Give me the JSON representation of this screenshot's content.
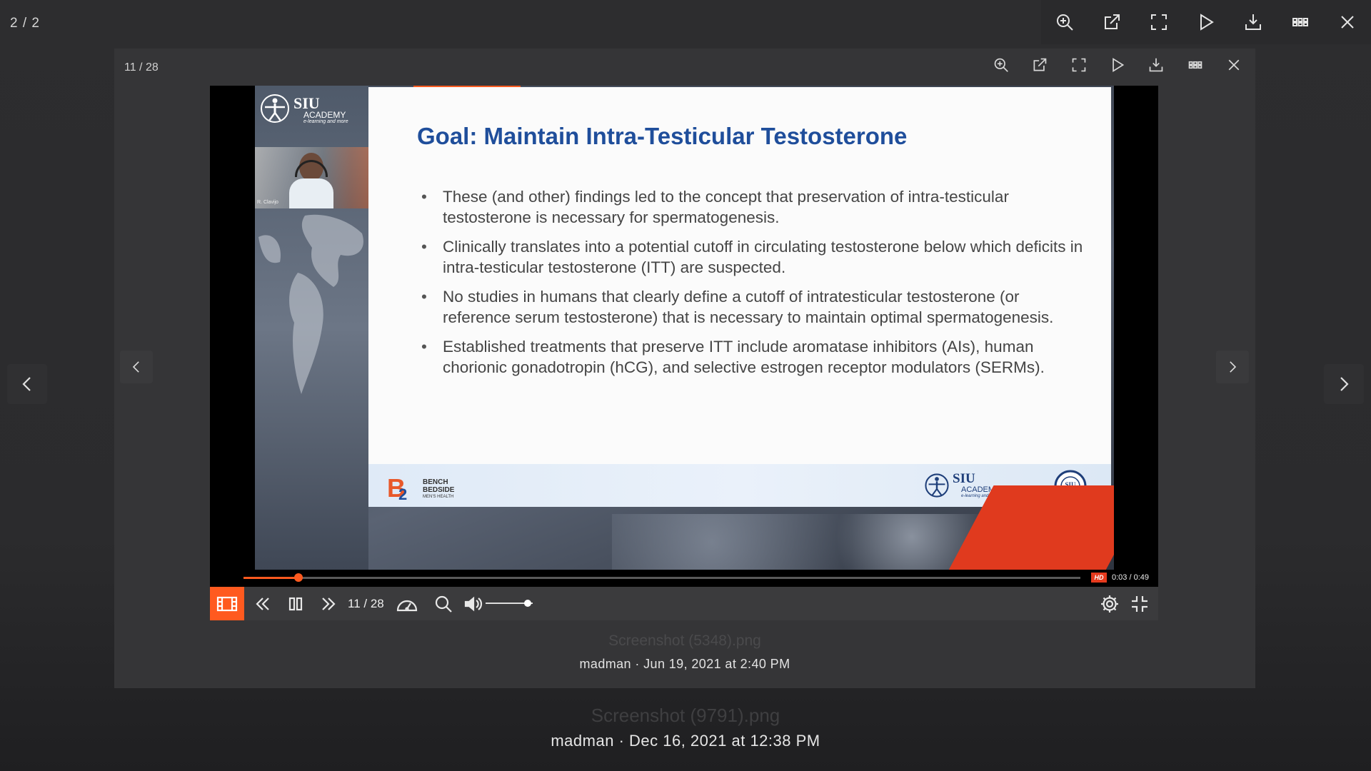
{
  "outer_viewer": {
    "counter": "2 / 2",
    "toolbar": [
      "zoom-in-icon",
      "open-external-icon",
      "fullscreen-icon",
      "play-icon",
      "download-icon",
      "grid-icon",
      "close-icon"
    ],
    "filename": "Screenshot (9791).png",
    "meta": "madman · Dec 16, 2021 at 12:38 PM"
  },
  "inner_viewer": {
    "counter": "11 / 28",
    "filename": "Screenshot (5348).png",
    "meta": "madman · Jun 19, 2021 at 2:40 PM"
  },
  "video": {
    "brand": "SIU",
    "brand_sub": "ACADEMY",
    "brand_tag": "e-learning and more",
    "presenter_name": "R. Clavijo",
    "slide": {
      "title": "Goal: Maintain Intra-Testicular Testosterone",
      "bullets": [
        "These (and other) findings led to the concept that preservation of  intra-testicular testosterone is necessary for spermatogenesis.",
        "Clinically translates into a potential cutoff in circulating testosterone below which deficits in intra-testicular testosterone (ITT) are suspected.",
        "No studies in humans that clearly define a cutoff of intratesticular testosterone (or reference serum testosterone) that is necessary to maintain optimal spermatogenesis.",
        "Established treatments that preserve ITT include aromatase inhibitors (AIs), human chorionic gonadotropin (hCG), and selective estrogen receptor modulators (SERMs)."
      ],
      "footer_left_line1": "BENCH",
      "footer_left_line2": "BEDSIDE",
      "footer_left_line3": "MEN'S HEALTH",
      "footer_right_brand": "SIU",
      "footer_right_sub": "ACADEMY",
      "footer_right_tag": "e-learning and more"
    }
  },
  "player": {
    "progress_fraction": 0.066,
    "hd_label": "HD",
    "time": "0:03 / 0:49",
    "slide_counter": "11 / 28",
    "volume_fraction": 0.9,
    "accent": "#ff5a1f"
  }
}
